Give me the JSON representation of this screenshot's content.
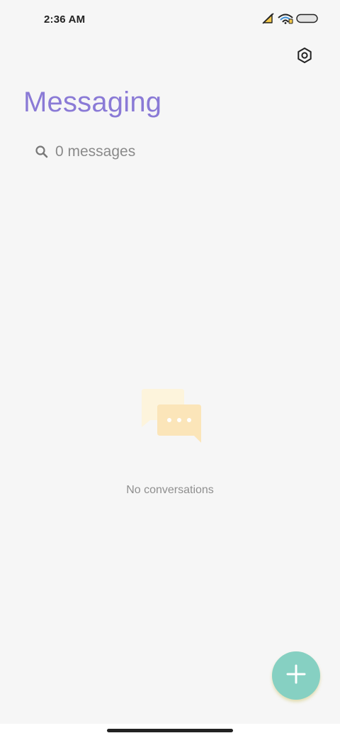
{
  "status_bar": {
    "time": "2:36 AM",
    "icons": [
      "no-sim-icon",
      "wifi-icon",
      "battery-icon"
    ]
  },
  "header": {
    "title": "Messaging",
    "settings_icon": "settings-icon"
  },
  "search": {
    "placeholder": "0 messages",
    "icon": "search-icon"
  },
  "empty_state": {
    "illustration": "chat-bubbles-icon",
    "text": "No conversations"
  },
  "fab": {
    "icon": "plus-icon"
  },
  "colors": {
    "title": "#8a7ad6",
    "fab": "#86d0c2",
    "background": "#f6f6f6"
  }
}
